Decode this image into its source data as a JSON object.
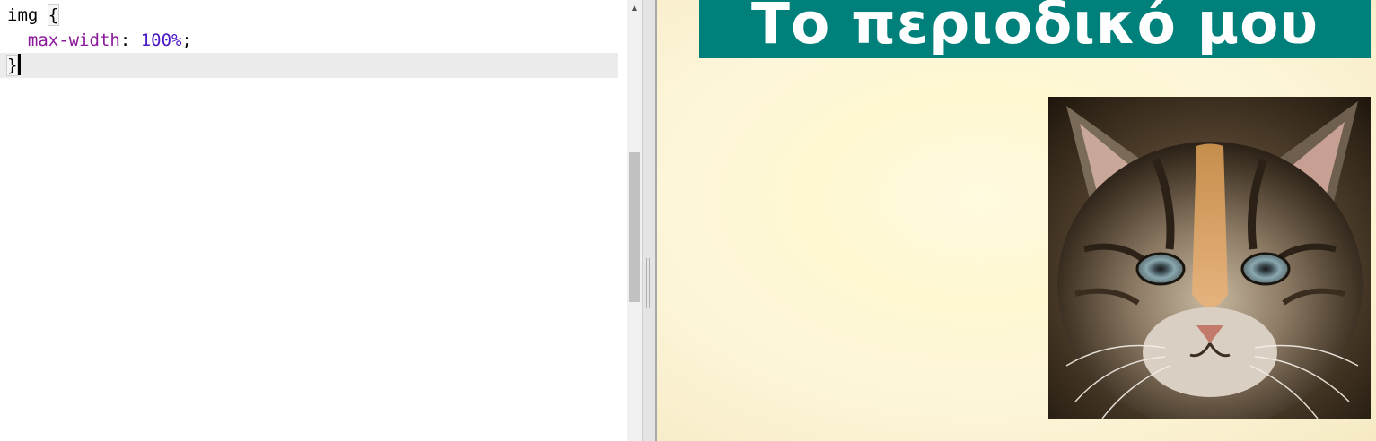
{
  "editor": {
    "lines": {
      "l1": {
        "selector": "img",
        "brace": "{"
      },
      "l2": {
        "property": "max-width",
        "colon": ": ",
        "value": "100%",
        "semi": ";"
      },
      "l3": {
        "brace": "}"
      }
    },
    "scroll_up_icon": "arrow-up-icon"
  },
  "preview": {
    "title": "Το περιοδικό μου",
    "header_color": "#00807b",
    "image_subject": "kitten"
  }
}
